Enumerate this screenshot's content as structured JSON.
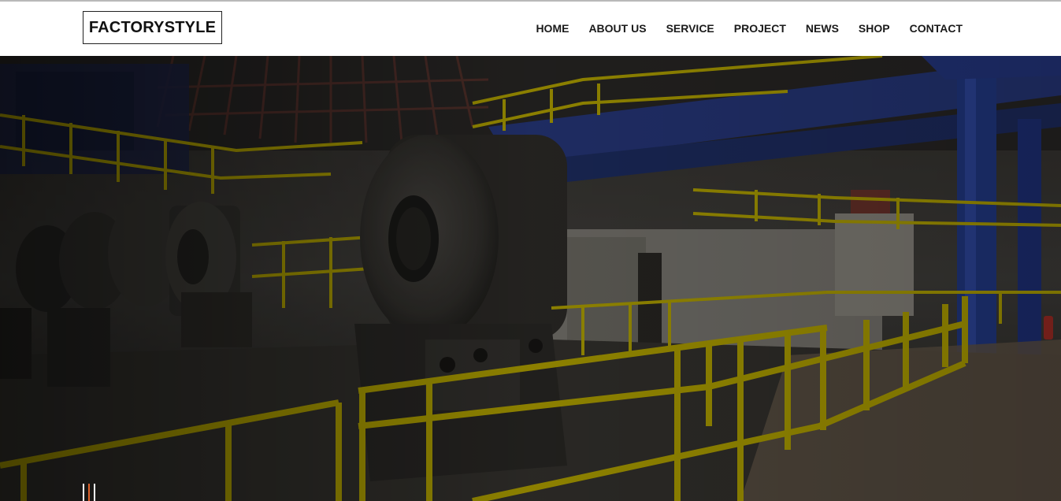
{
  "brand": {
    "logo_text": "FACTORYSTYLE"
  },
  "nav": {
    "items": [
      {
        "label": "HOME"
      },
      {
        "label": "ABOUT US"
      },
      {
        "label": "SERVICE"
      },
      {
        "label": "PROJECT"
      },
      {
        "label": "NEWS"
      },
      {
        "label": "SHOP"
      },
      {
        "label": "CONTACT"
      }
    ]
  },
  "hero": {
    "image_icon": "factory-steel-coil-photo",
    "slider_icon": "slider-indicator-icon"
  },
  "colors": {
    "header_bg": "#ffffff",
    "nav_text": "#1a1a1a",
    "rail_yellow": "#c9b800",
    "beam_blue": "#27419a",
    "indicator_orange": "#e0622b",
    "indicator_white": "#ffffff"
  }
}
